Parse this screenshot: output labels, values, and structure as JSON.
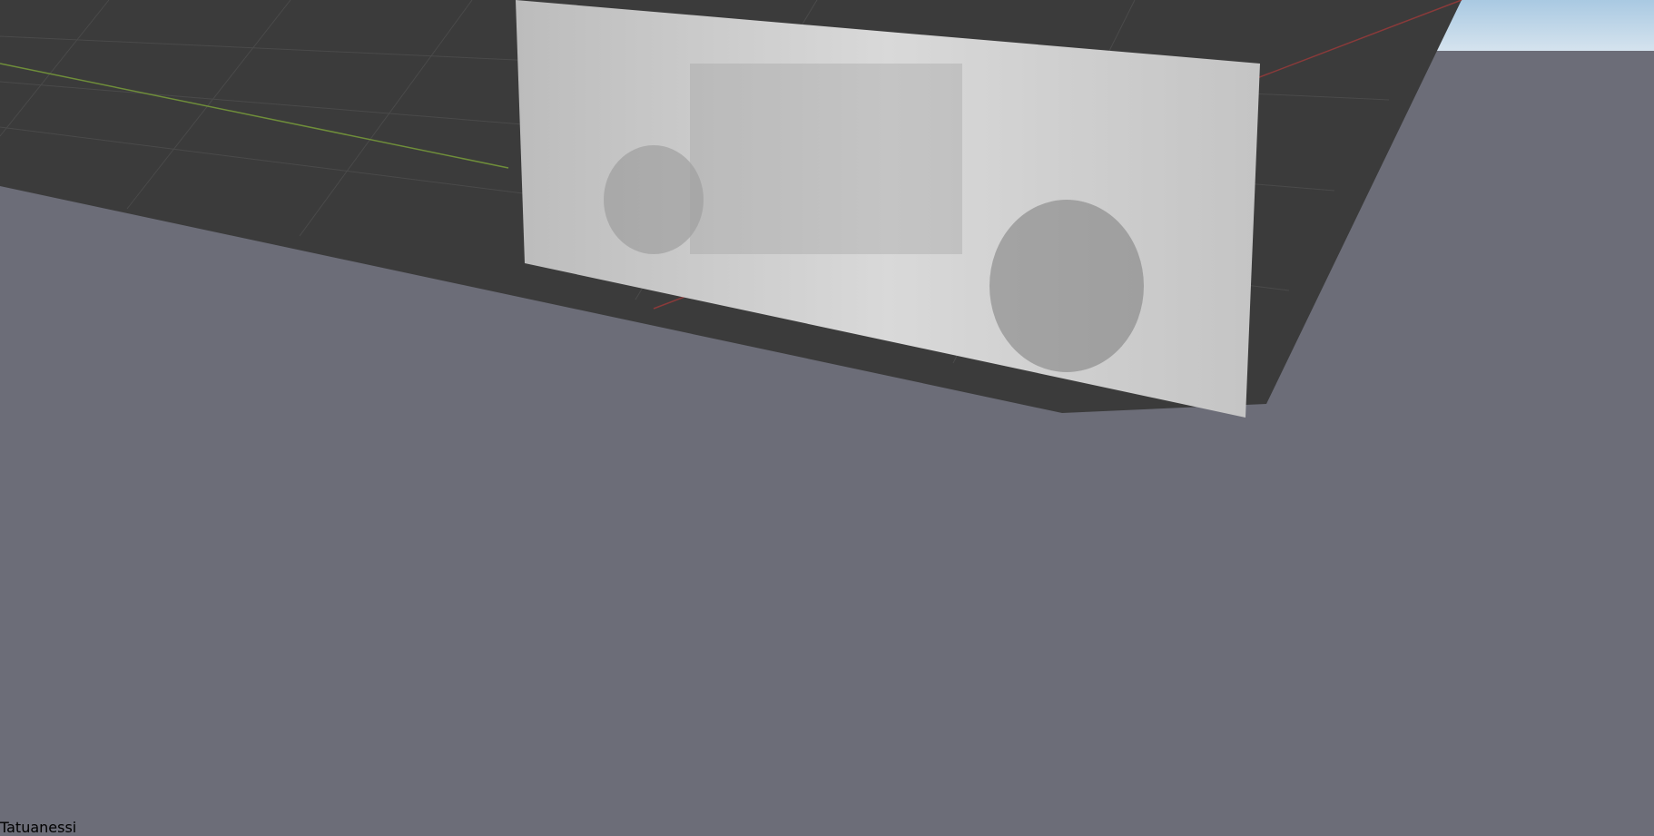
{
  "scene": {
    "description_visible_text": "Tatuanessi",
    "colors": {
      "background_gray": "#6c6d78",
      "dark_viewport": "#3a3a3a",
      "sky": "#b9d3e6",
      "wireframe_cyan": "#1de3e3",
      "green_car_body": "#0e4a3a",
      "green_car_roof": "#4b6446",
      "tan_car_body": "#c9a47c",
      "tan_car_fenders": "#6e2f35",
      "tan_car_roof": "#1e1e1e",
      "grid_blue": "#5f5fd8",
      "grid_cyan": "#5ad6d6"
    }
  }
}
